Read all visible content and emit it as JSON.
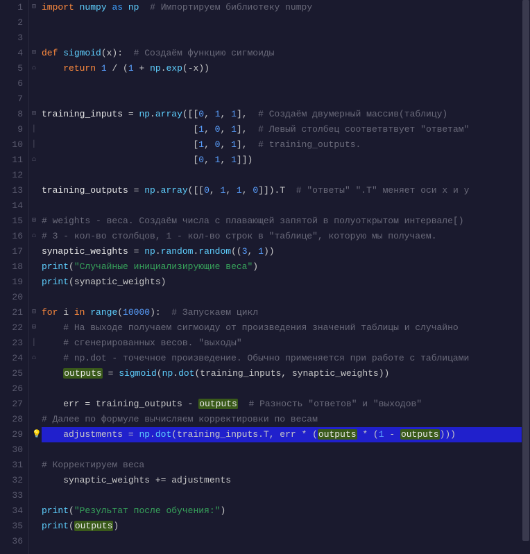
{
  "lines": [
    {
      "n": 1,
      "fold": "⊟",
      "tokens": [
        [
          "kw",
          "import"
        ],
        [
          "pun",
          " "
        ],
        [
          "mod",
          "numpy"
        ],
        [
          "pun",
          " "
        ],
        [
          "kw2",
          "as"
        ],
        [
          "pun",
          " "
        ],
        [
          "mod",
          "np"
        ],
        [
          "pun",
          "  "
        ],
        [
          "cmt",
          "# Импортируем библиотеку numpy"
        ]
      ]
    },
    {
      "n": 2,
      "fold": "",
      "tokens": []
    },
    {
      "n": 3,
      "fold": "",
      "tokens": []
    },
    {
      "n": 4,
      "fold": "⊟",
      "tokens": [
        [
          "kw",
          "def"
        ],
        [
          "pun",
          " "
        ],
        [
          "mod",
          "sigmoid"
        ],
        [
          "pun",
          "(x):  "
        ],
        [
          "cmt",
          "# Создаём функцию сигмоиды"
        ]
      ]
    },
    {
      "n": 5,
      "fold": "⌂",
      "tokens": [
        [
          "pun",
          "    "
        ],
        [
          "kw",
          "return"
        ],
        [
          "pun",
          " "
        ],
        [
          "num",
          "1"
        ],
        [
          "pun",
          " / ("
        ],
        [
          "num",
          "1"
        ],
        [
          "pun",
          " + "
        ],
        [
          "mod",
          "np"
        ],
        [
          "pun",
          "."
        ],
        [
          "mod",
          "exp"
        ],
        [
          "pun",
          "(-x))"
        ]
      ]
    },
    {
      "n": 6,
      "fold": "",
      "tokens": []
    },
    {
      "n": 7,
      "fold": "",
      "tokens": []
    },
    {
      "n": 8,
      "fold": "⊟",
      "tokens": [
        [
          "var",
          "training_inputs"
        ],
        [
          "pun",
          " = "
        ],
        [
          "mod",
          "np"
        ],
        [
          "pun",
          "."
        ],
        [
          "mod",
          "array"
        ],
        [
          "pun",
          "([["
        ],
        [
          "num",
          "0"
        ],
        [
          "pun",
          ", "
        ],
        [
          "num",
          "1"
        ],
        [
          "pun",
          ", "
        ],
        [
          "num",
          "1"
        ],
        [
          "pun",
          "],  "
        ],
        [
          "cmt",
          "# Создаём двумерный массив(таблицу)"
        ]
      ]
    },
    {
      "n": 9,
      "fold": "│",
      "tokens": [
        [
          "pun",
          "                            ["
        ],
        [
          "num",
          "1"
        ],
        [
          "pun",
          ", "
        ],
        [
          "num",
          "0"
        ],
        [
          "pun",
          ", "
        ],
        [
          "num",
          "1"
        ],
        [
          "pun",
          "],  "
        ],
        [
          "cmt",
          "# Левый столбец соответвтвует \"ответам\""
        ]
      ]
    },
    {
      "n": 10,
      "fold": "│",
      "tokens": [
        [
          "pun",
          "                            ["
        ],
        [
          "num",
          "1"
        ],
        [
          "pun",
          ", "
        ],
        [
          "num",
          "0"
        ],
        [
          "pun",
          ", "
        ],
        [
          "num",
          "1"
        ],
        [
          "pun",
          "],  "
        ],
        [
          "cmt",
          "# training_outputs."
        ]
      ]
    },
    {
      "n": 11,
      "fold": "⌂",
      "tokens": [
        [
          "pun",
          "                            ["
        ],
        [
          "num",
          "0"
        ],
        [
          "pun",
          ", "
        ],
        [
          "num",
          "1"
        ],
        [
          "pun",
          ", "
        ],
        [
          "num",
          "1"
        ],
        [
          "pun",
          "]])"
        ]
      ]
    },
    {
      "n": 12,
      "fold": "",
      "tokens": []
    },
    {
      "n": 13,
      "fold": "",
      "tokens": [
        [
          "var",
          "training_outputs"
        ],
        [
          "pun",
          " = "
        ],
        [
          "mod",
          "np"
        ],
        [
          "pun",
          "."
        ],
        [
          "mod",
          "array"
        ],
        [
          "pun",
          "([["
        ],
        [
          "num",
          "0"
        ],
        [
          "pun",
          ", "
        ],
        [
          "num",
          "1"
        ],
        [
          "pun",
          ", "
        ],
        [
          "num",
          "1"
        ],
        [
          "pun",
          ", "
        ],
        [
          "num",
          "0"
        ],
        [
          "pun",
          "]]).T  "
        ],
        [
          "cmt",
          "# \"ответы\" \".T\" меняет оси x и y"
        ]
      ]
    },
    {
      "n": 14,
      "fold": "",
      "tokens": []
    },
    {
      "n": 15,
      "fold": "⊟",
      "tokens": [
        [
          "cmt",
          "# weights - веса. Создаём числа с плавающей запятой в полуоткрытом интервале[)"
        ]
      ]
    },
    {
      "n": 16,
      "fold": "⌂",
      "tokens": [
        [
          "cmt",
          "# 3 - кол-во столбцов, 1 - кол-во строк в \"таблице\", которую мы получаем."
        ]
      ]
    },
    {
      "n": 17,
      "fold": "",
      "tokens": [
        [
          "var",
          "synaptic_weights"
        ],
        [
          "pun",
          " = "
        ],
        [
          "mod",
          "np"
        ],
        [
          "pun",
          "."
        ],
        [
          "mod",
          "random"
        ],
        [
          "pun",
          "."
        ],
        [
          "mod",
          "random"
        ],
        [
          "pun",
          "(("
        ],
        [
          "num",
          "3"
        ],
        [
          "pun",
          ", "
        ],
        [
          "num",
          "1"
        ],
        [
          "pun",
          "))"
        ]
      ]
    },
    {
      "n": 18,
      "fold": "",
      "tokens": [
        [
          "mod",
          "print"
        ],
        [
          "pun",
          "("
        ],
        [
          "str",
          "\"Случайные инициализирующие веса\""
        ],
        [
          "pun",
          ")"
        ]
      ]
    },
    {
      "n": 19,
      "fold": "",
      "tokens": [
        [
          "mod",
          "print"
        ],
        [
          "pun",
          "(synaptic_weights)"
        ]
      ]
    },
    {
      "n": 20,
      "fold": "",
      "tokens": []
    },
    {
      "n": 21,
      "fold": "⊟",
      "tokens": [
        [
          "kw",
          "for"
        ],
        [
          "pun",
          " i "
        ],
        [
          "kw",
          "in"
        ],
        [
          "pun",
          " "
        ],
        [
          "mod",
          "range"
        ],
        [
          "pun",
          "("
        ],
        [
          "num",
          "10000"
        ],
        [
          "pun",
          "):  "
        ],
        [
          "cmt",
          "# Запускаем цикл"
        ]
      ]
    },
    {
      "n": 22,
      "fold": "⊟",
      "tokens": [
        [
          "pun",
          "    "
        ],
        [
          "cmt",
          "# На выходе получаем сигмоиду от произведения значений таблицы и случайно"
        ]
      ]
    },
    {
      "n": 23,
      "fold": "│",
      "tokens": [
        [
          "pun",
          "    "
        ],
        [
          "cmt",
          "# сгенерированных весов. \"выходы\""
        ]
      ]
    },
    {
      "n": 24,
      "fold": "⌂",
      "tokens": [
        [
          "pun",
          "    "
        ],
        [
          "cmt",
          "# np.dot - точечное произведение. Обычно применяется при работе с таблицами"
        ]
      ]
    },
    {
      "n": 25,
      "fold": "",
      "tokens": [
        [
          "pun",
          "    "
        ],
        [
          "hlvar",
          "outputs"
        ],
        [
          "pun",
          " = "
        ],
        [
          "mod",
          "sigmoid"
        ],
        [
          "pun",
          "("
        ],
        [
          "mod",
          "np"
        ],
        [
          "pun",
          "."
        ],
        [
          "mod",
          "dot"
        ],
        [
          "pun",
          "(training_inputs, synaptic_weights))"
        ]
      ]
    },
    {
      "n": 26,
      "fold": "",
      "tokens": []
    },
    {
      "n": 27,
      "fold": "",
      "tokens": [
        [
          "pun",
          "    err = training_outputs - "
        ],
        [
          "hlvar",
          "outputs"
        ],
        [
          "pun",
          "  "
        ],
        [
          "cmt",
          "# Разность \"ответов\" и \"выходов\""
        ]
      ]
    },
    {
      "n": 28,
      "fold": "",
      "tokens": [
        [
          "cmt",
          "# Далее по формуле вычисляем корректировки по весам"
        ]
      ]
    },
    {
      "n": 29,
      "fold": "",
      "hl": true,
      "bulb": true,
      "tokens": [
        [
          "pun",
          "    adjustments = "
        ],
        [
          "mod",
          "np"
        ],
        [
          "pun",
          "."
        ],
        [
          "mod",
          "dot"
        ],
        [
          "pun",
          "(training_inputs.T, err * ("
        ],
        [
          "hlvar",
          "outputs"
        ],
        [
          "pun",
          " * ("
        ],
        [
          "num",
          "1"
        ],
        [
          "pun",
          " - "
        ],
        [
          "hlvar",
          "outputs"
        ],
        [
          "pun",
          ")))"
        ]
      ]
    },
    {
      "n": 30,
      "fold": "",
      "tokens": []
    },
    {
      "n": 31,
      "fold": "",
      "tokens": [
        [
          "cmt",
          "# Корректируем веса"
        ]
      ]
    },
    {
      "n": 32,
      "fold": "",
      "tokens": [
        [
          "pun",
          "    synaptic_weights += adjustments"
        ]
      ]
    },
    {
      "n": 33,
      "fold": "",
      "tokens": []
    },
    {
      "n": 34,
      "fold": "",
      "tokens": [
        [
          "mod",
          "print"
        ],
        [
          "pun",
          "("
        ],
        [
          "str",
          "\"Результат после обучения:\""
        ],
        [
          "pun",
          ")"
        ]
      ]
    },
    {
      "n": 35,
      "fold": "",
      "tokens": [
        [
          "mod",
          "print"
        ],
        [
          "pun",
          "("
        ],
        [
          "hlvar",
          "outputs"
        ],
        [
          "pun",
          ")"
        ]
      ]
    },
    {
      "n": 36,
      "fold": "",
      "tokens": []
    }
  ]
}
